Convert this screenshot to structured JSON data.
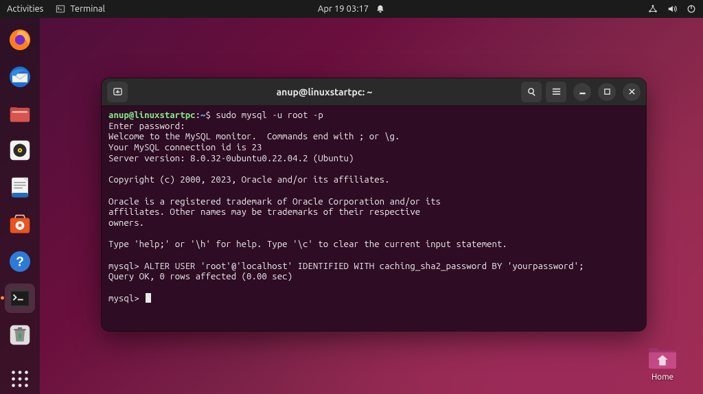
{
  "topbar": {
    "activities": "Activities",
    "app_icon": "terminal-icon",
    "app_name": "Terminal",
    "clock": "Apr 19  03:17"
  },
  "dock": {
    "items": [
      {
        "name": "firefox-icon"
      },
      {
        "name": "thunderbird-icon"
      },
      {
        "name": "files-icon"
      },
      {
        "name": "rhythmbox-icon"
      },
      {
        "name": "writer-icon"
      },
      {
        "name": "software-icon"
      },
      {
        "name": "help-icon"
      },
      {
        "name": "terminal-icon",
        "running": true,
        "active": true
      },
      {
        "name": "trash-icon"
      }
    ],
    "apps": "show-applications"
  },
  "desktop": {
    "home_label": "Home"
  },
  "terminal": {
    "title": "anup@linuxstartpc: ~",
    "prompt": {
      "user": "anup@linuxstartpc",
      "sep": ":",
      "path": "~",
      "sigil": "$"
    },
    "cmd1": "sudo mysql -u root -p",
    "lines_intro": [
      "Enter password:",
      "Welcome to the MySQL monitor.  Commands end with ; or \\g.",
      "Your MySQL connection id is 23",
      "Server version: 8.0.32-0ubuntu0.22.04.2 (Ubuntu)",
      "",
      "Copyright (c) 2000, 2023, Oracle and/or its affiliates.",
      "",
      "Oracle is a registered trademark of Oracle Corporation and/or its",
      "affiliates. Other names may be trademarks of their respective",
      "owners.",
      "",
      "Type 'help;' or '\\h' for help. Type '\\c' to clear the current input statement.",
      ""
    ],
    "mysql_prompt": "mysql>",
    "stmt": "ALTER USER 'root'@'localhost' IDENTIFIED WITH caching_sha2_password BY 'yourpassword';",
    "result": "Query OK, 0 rows affected (0.00 sec)"
  }
}
